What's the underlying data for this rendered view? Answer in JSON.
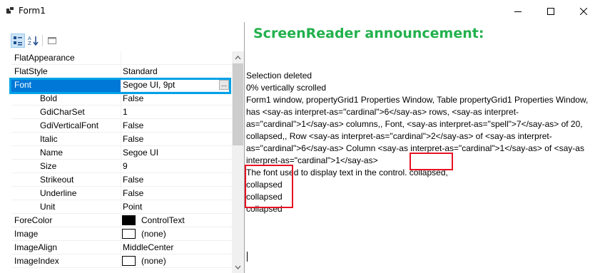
{
  "window": {
    "title": "Form1",
    "icon": "form-icon",
    "controls": [
      "minimize-icon",
      "maximize-icon",
      "close-icon"
    ]
  },
  "toolbar": {
    "buttons": [
      {
        "icon": "categorized-icon",
        "active": true
      },
      {
        "icon": "alphabetical-sort-icon",
        "active": false
      },
      {
        "icon": "property-pages-icon",
        "active": false
      }
    ]
  },
  "property_grid": {
    "rows": [
      {
        "name": "FlatAppearance",
        "value": "",
        "expandable": true,
        "expanded": false
      },
      {
        "name": "FlatStyle",
        "value": "Standard"
      },
      {
        "name": "Font",
        "value": "Segoe UI, 9pt",
        "expandable": true,
        "expanded": true,
        "selected": true,
        "ellipsis": "..."
      },
      {
        "name": "Bold",
        "value": "False",
        "sub": true
      },
      {
        "name": "GdiCharSet",
        "value": "1",
        "sub": true
      },
      {
        "name": "GdiVerticalFont",
        "value": "False",
        "sub": true
      },
      {
        "name": "Italic",
        "value": "False",
        "sub": true
      },
      {
        "name": "Name",
        "value": "Segoe UI",
        "sub": true
      },
      {
        "name": "Size",
        "value": "9",
        "sub": true
      },
      {
        "name": "Strikeout",
        "value": "False",
        "sub": true
      },
      {
        "name": "Underline",
        "value": "False",
        "sub": true
      },
      {
        "name": "Unit",
        "value": "Point",
        "sub": true
      },
      {
        "name": "ForeColor",
        "value": "ControlText",
        "swatch": "#000000"
      },
      {
        "name": "Image",
        "value": "(none)",
        "swatch": "#ffffff"
      },
      {
        "name": "ImageAlign",
        "value": "MiddleCenter"
      },
      {
        "name": "ImageIndex",
        "value": "(none)",
        "swatch": "#ffffff"
      }
    ]
  },
  "reader": {
    "heading": "ScreenReader announcement:",
    "lines": [
      "Selection deleted",
      "0% vertically scrolled",
      "Form1 window, propertyGrid1 Properties Window, Table propertyGrid1 Properties Window,",
      "has <say-as interpret-as=\"cardinal\">6</say-as> rows, <say-as interpret-",
      "as=\"cardinal\">1</say-as> columns,, Font, <say-as interpret-as=\"spell\">7</say-as> of 20,",
      "collapsed,, Row <say-as interpret-as=\"cardinal\">2</say-as> of <say-as interpret-",
      "as=\"cardinal\">6</say-as> Column <say-as interpret-as=\"cardinal\">1</say-as> of <say-as",
      "interpret-as=\"cardinal\">1</say-as>",
      "The font used to display text in the control. collapsed,",
      "collapsed",
      "collapsed",
      "collapsed"
    ]
  },
  "colors": {
    "heading": "#22b14c",
    "selection": "#0078d7",
    "focus_outline": "#00a2e8",
    "annotation_box": "#e81123"
  }
}
